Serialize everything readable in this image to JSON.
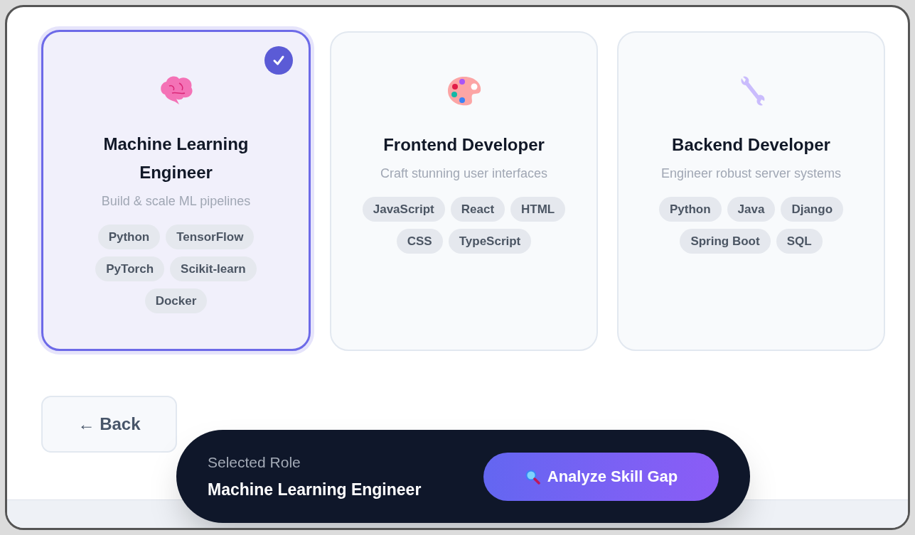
{
  "roles": [
    {
      "kind": "brain",
      "title": "Machine Learning Engineer",
      "description": "Build & scale ML pipelines",
      "tags": [
        "Python",
        "TensorFlow",
        "PyTorch",
        "Scikit-learn",
        "Docker"
      ],
      "selected": true
    },
    {
      "kind": "palette",
      "title": "Frontend Developer",
      "description": "Craft stunning user interfaces",
      "tags": [
        "JavaScript",
        "React",
        "HTML",
        "CSS",
        "TypeScript"
      ],
      "selected": false
    },
    {
      "kind": "wrench",
      "title": "Backend Developer",
      "description": "Engineer robust server systems",
      "tags": [
        "Python",
        "Java",
        "Django",
        "Spring Boot",
        "SQL"
      ],
      "selected": false
    }
  ],
  "back_button": "← Back",
  "selection_bar": {
    "label": "Selected Role",
    "value": "Machine Learning Engineer",
    "action": "Analyze Skill Gap"
  }
}
